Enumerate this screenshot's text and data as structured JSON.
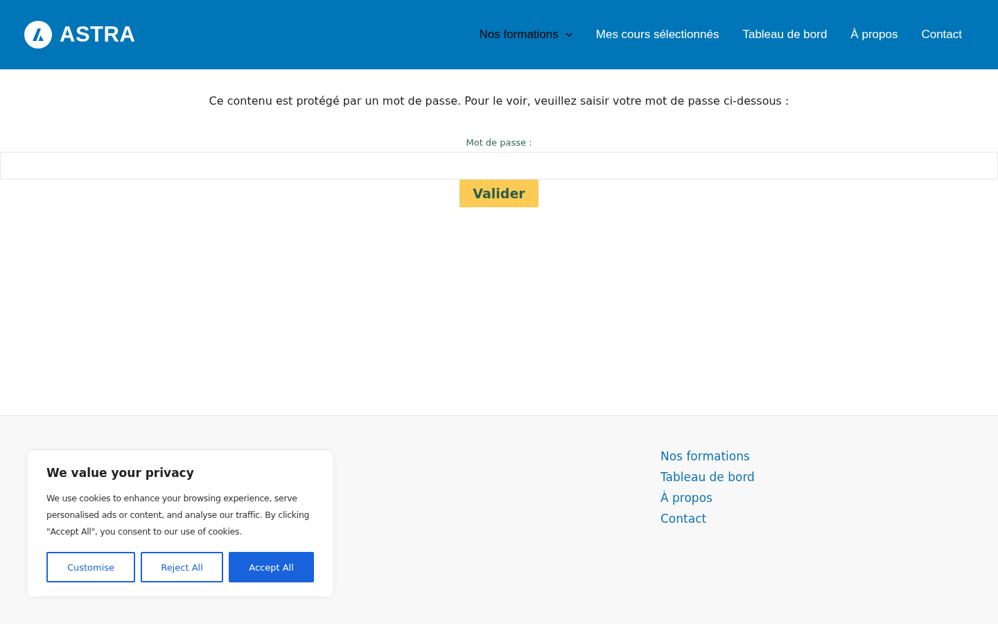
{
  "header": {
    "logo": "ASTRA",
    "nav": [
      {
        "label": "Nos formations",
        "selected": true,
        "has_submenu": true
      },
      {
        "label": "Mes cours sélectionnés",
        "selected": false,
        "has_submenu": false
      },
      {
        "label": "Tableau de bord",
        "selected": false,
        "has_submenu": false
      },
      {
        "label": "À propos",
        "selected": false,
        "has_submenu": false
      },
      {
        "label": "Contact",
        "selected": false,
        "has_submenu": false
      }
    ]
  },
  "content": {
    "message": "Ce contenu est protégé par un mot de passe. Pour le voir, veuillez saisir votre mot de passe ci-dessous :",
    "password_label": "Mot de passe :",
    "submit": "Valider"
  },
  "footer": {
    "links": [
      "Nos formations",
      "Tableau de bord",
      "À propos",
      "Contact"
    ]
  },
  "cookie_banner": {
    "title": "We value your privacy",
    "text": "We use cookies to enhance your browsing experience, serve personalised ads or content, and analyse our traffic. By clicking \"Accept All\", you consent to our use of cookies.",
    "buttons": [
      {
        "label": "Customise",
        "kind": "outline"
      },
      {
        "label": "Reject All",
        "kind": "outline"
      },
      {
        "label": "Accept All",
        "kind": "primary"
      }
    ]
  }
}
